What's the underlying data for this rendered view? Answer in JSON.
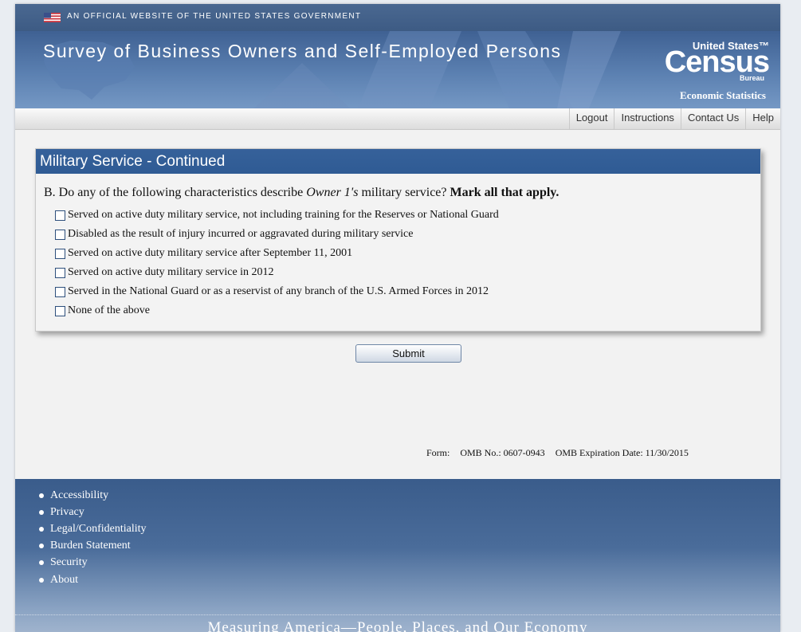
{
  "gov_banner": {
    "text": "AN OFFICIAL WEBSITE OF THE UNITED STATES GOVERNMENT"
  },
  "header": {
    "survey_title": "Survey of Business Owners and Self-Employed Persons",
    "logo": {
      "united_states": "United States™",
      "census": "Census",
      "bureau": "Bureau",
      "economic_statistics": "Economic Statistics"
    }
  },
  "nav": {
    "links": [
      "Logout",
      "Instructions",
      "Contact Us",
      "Help"
    ]
  },
  "panel": {
    "title": "Military Service - Continued",
    "question": {
      "prefix": "B. Do any of the following characteristics describe ",
      "owner": "Owner 1's",
      "middle": " military service? ",
      "instruction": "Mark all that apply."
    },
    "options": [
      {
        "label": "Served on active duty military service, not including training for the Reserves or National Guard",
        "checked": false
      },
      {
        "label": "Disabled as the result of injury incurred or aggravated during military service",
        "checked": false
      },
      {
        "label": "Served on active duty military service after September 11, 2001",
        "checked": false
      },
      {
        "label": "Served on active duty military service in 2012",
        "checked": false
      },
      {
        "label": "Served in the National Guard or as a reservist of any branch of the U.S. Armed Forces in 2012",
        "checked": false
      },
      {
        "label": "None of the above",
        "checked": false
      }
    ]
  },
  "submit": {
    "label": "Submit"
  },
  "form_info": {
    "form": "Form:",
    "omb_no": "OMB No.: 0607-0943",
    "omb_expiration": "OMB Expiration Date: 11/30/2015"
  },
  "footer": {
    "links": [
      "Accessibility",
      "Privacy",
      "Legal/Confidentiality",
      "Burden Statement",
      "Security",
      "About"
    ],
    "tagline": "Measuring America—People, Places, and Our Economy"
  },
  "colors": {
    "header_blue": "#3f6193",
    "panel_header_blue": "#2f5b94",
    "footer_blue": "#3a5c8b"
  }
}
